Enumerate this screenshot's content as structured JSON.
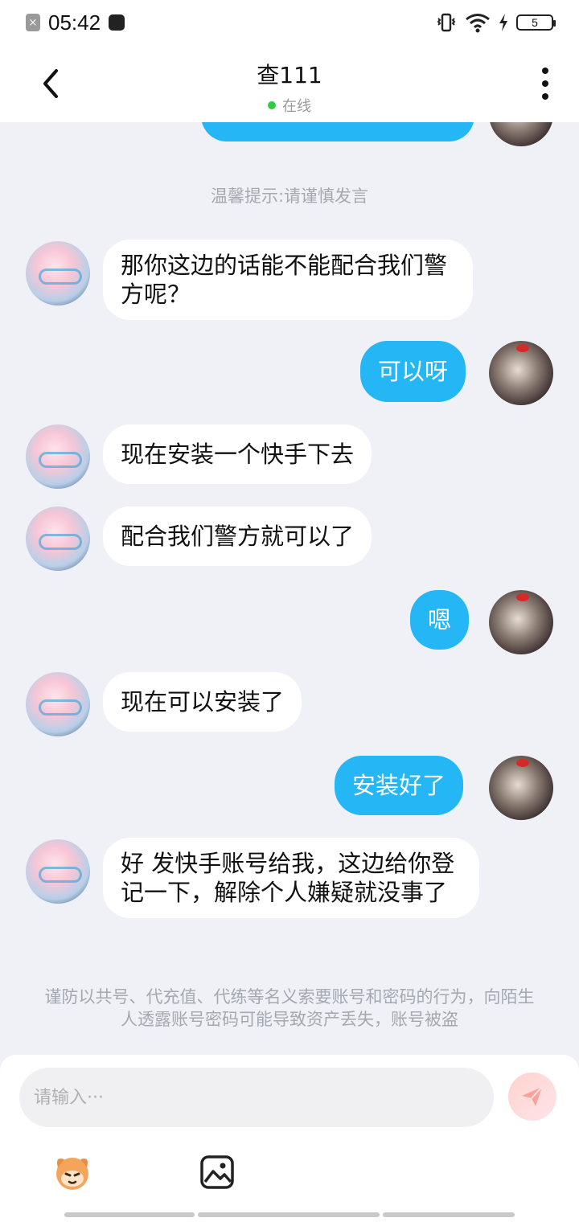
{
  "status_bar": {
    "time": "05:42",
    "battery": "5"
  },
  "header": {
    "title": "查111",
    "status": "在线"
  },
  "chat": {
    "notice_top": "温馨提示:请谨慎发言",
    "messages": [
      {
        "from": "them",
        "text": "那你这边的话能不能配合我们警方呢？"
      },
      {
        "from": "me",
        "text": "可以呀"
      },
      {
        "from": "them",
        "text": "现在安装一个快手下去"
      },
      {
        "from": "them",
        "text": "配合我们警方就可以了"
      },
      {
        "from": "me",
        "text": "嗯"
      },
      {
        "from": "them",
        "text": "现在可以安装了"
      },
      {
        "from": "me",
        "text": "安装好了"
      },
      {
        "from": "them",
        "text": "好 发快手账号给我，这边给你登记一下，解除个人嫌疑就没事了"
      }
    ],
    "notice_bottom": "谨防以共号、代充值、代练等名义索要账号和密码的行为，向陌生人透露账号密码可能导致资产丢失，账号被盗"
  },
  "input": {
    "placeholder": "请输入···"
  },
  "icons": {
    "back": "chevron-left-icon",
    "more": "more-vertical-icon",
    "send": "send-icon",
    "emoji": "emoji-icon",
    "image": "image-icon"
  },
  "colors": {
    "accent": "#25b7f5",
    "online": "#2ecc40"
  }
}
